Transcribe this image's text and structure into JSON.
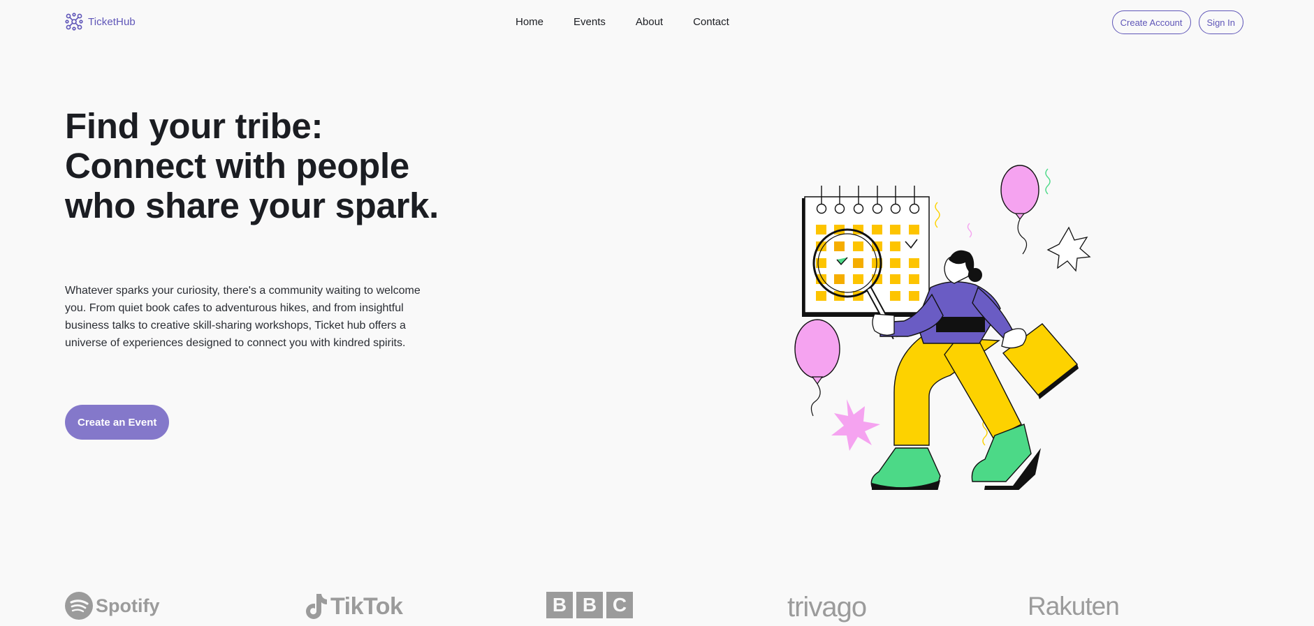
{
  "header": {
    "logo_text": "TicketHub",
    "nav": [
      {
        "label": "Home"
      },
      {
        "label": "Events"
      },
      {
        "label": "About"
      },
      {
        "label": "Contact"
      }
    ],
    "create_account_label": "Create Account",
    "sign_in_label": "Sign In"
  },
  "hero": {
    "title": "Find your tribe: Connect with people who share your spark.",
    "description": "Whatever sparks your curiosity, there's a community waiting to welcome you. From quiet book cafes to adventurous hikes, and from insightful business talks to creative skill-sharing workshops, Ticket hub offers a universe of experiences designed to connect you with kindred spirits.",
    "cta_label": "Create an Event"
  },
  "brands": {
    "spotify": "Spotify",
    "tiktok": "TikTok",
    "bbc": [
      "B",
      "B",
      "C"
    ],
    "trivago": "trivago",
    "rakuten": "Rakuten"
  },
  "colors": {
    "accent": "#5f56b8",
    "cta_bg": "#8478ca",
    "background": "#f9f9f9",
    "text": "#1b1d22",
    "brand_gray": "#9b9b9b",
    "illustration_purple": "#6a5cc4",
    "illustration_yellow": "#fdd200",
    "illustration_pink": "#f5a3f0",
    "illustration_green": "#4cd987",
    "illustration_orange": "#f5ad00"
  },
  "icons": {
    "logo": "network-nodes-icon",
    "illustration": "person-calendar-magnifier-illustration"
  }
}
